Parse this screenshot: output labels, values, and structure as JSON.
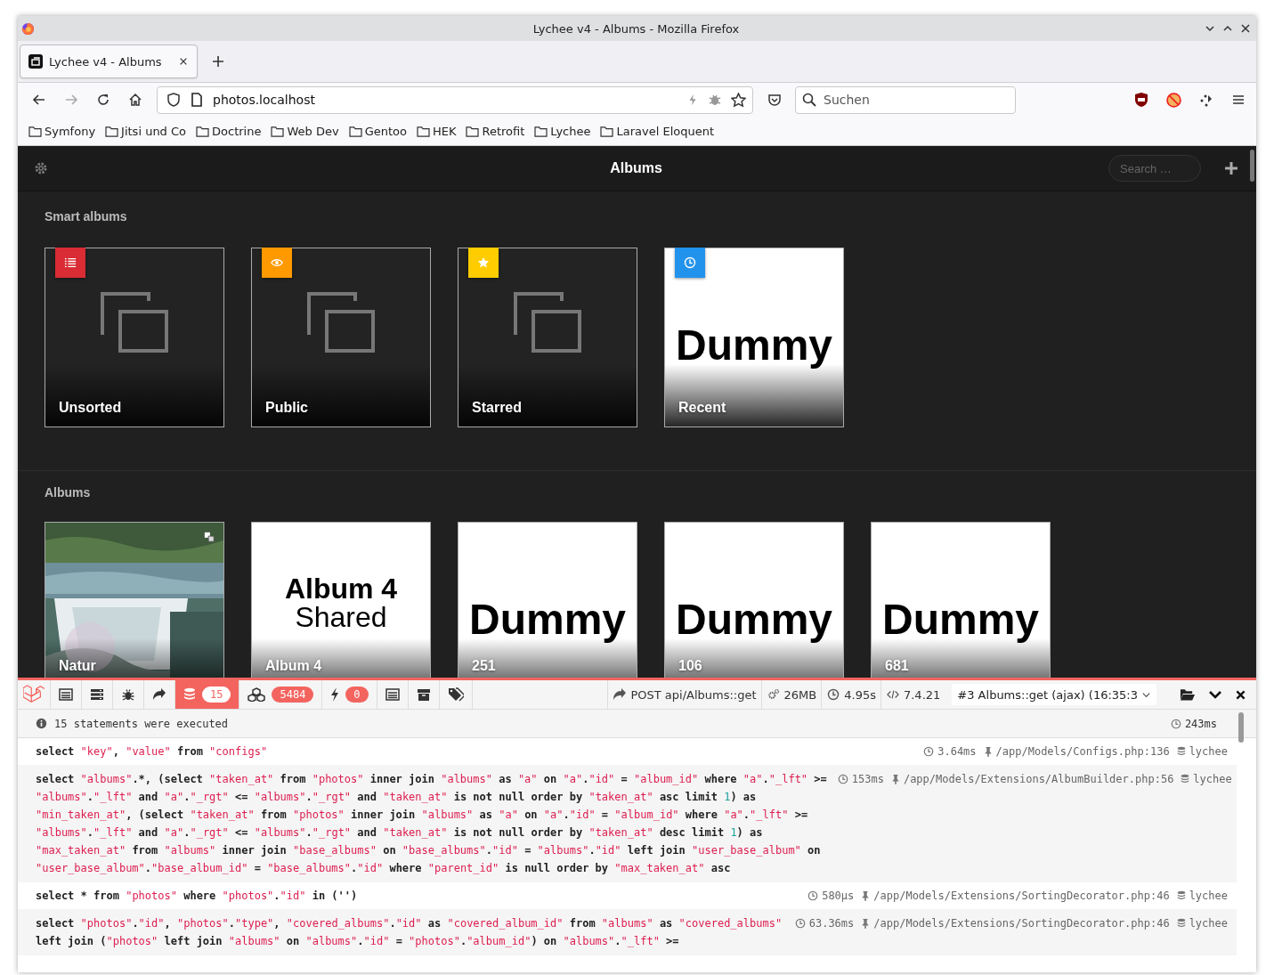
{
  "window": {
    "title": "Lychee v4 - Albums - Mozilla Firefox"
  },
  "tabs": [
    {
      "label": "Lychee v4 - Albums",
      "selected": true
    }
  ],
  "address_bar": {
    "value": "photos.localhost"
  },
  "search_bar": {
    "placeholder": "Suchen"
  },
  "bookmarks": [
    "Symfony",
    "Jitsi und Co",
    "Doctrine",
    "Web Dev",
    "Gentoo",
    "HEK",
    "Retrofit",
    "Lychee",
    "Laravel Eloquent"
  ],
  "app": {
    "title": "Albums",
    "search": {
      "placeholder": "Search …"
    }
  },
  "smart_albums": {
    "heading": "Smart albums",
    "items": [
      {
        "title": "Unsorted",
        "kind": "unsorted",
        "color": "#d92c34"
      },
      {
        "title": "Public",
        "kind": "public",
        "color": "#ff9900"
      },
      {
        "title": "Starred",
        "kind": "starred",
        "color": "#ffcc00"
      },
      {
        "title": "Recent",
        "kind": "recent",
        "color": "#2293ec",
        "cover_text": [
          "Dummy"
        ]
      }
    ]
  },
  "albums": {
    "heading": "Albums",
    "items": [
      {
        "title": "Natur",
        "kind": "picture"
      },
      {
        "title": "Album 4",
        "kind": "text",
        "cover_text": [
          "Album 4",
          "Shared"
        ]
      },
      {
        "title": "251",
        "kind": "text",
        "cover_text": [
          "Dummy"
        ]
      },
      {
        "title": "106",
        "kind": "text",
        "cover_text": [
          "Dummy"
        ]
      },
      {
        "title": "681",
        "kind": "text",
        "cover_text": [
          "Dummy"
        ]
      }
    ]
  },
  "debugbar": {
    "tabs": [
      {
        "kind": "messages",
        "selected": false
      },
      {
        "kind": "timeline",
        "selected": false
      },
      {
        "kind": "exceptions",
        "selected": false
      },
      {
        "kind": "route",
        "selected": false
      },
      {
        "kind": "queries",
        "badge": "15",
        "selected": true
      },
      {
        "kind": "models",
        "badge": "5484",
        "selected": false
      },
      {
        "kind": "events",
        "badge": "0",
        "selected": false
      },
      {
        "kind": "views",
        "selected": false
      },
      {
        "kind": "session",
        "selected": false
      },
      {
        "kind": "tags",
        "selected": false
      }
    ],
    "request": "POST api/Albums::get",
    "memory": "26MB",
    "duration": "4.95s",
    "php_version": "7.4.21",
    "request_select": {
      "value": "#3 Albums::get (ajax) (16:35:3"
    },
    "queries": {
      "summary": "15 statements were executed",
      "total_time": "243ms",
      "statements": [
        {
          "lines": [
            "select \"key\", \"value\" from \"configs\""
          ],
          "duration": "3.64ms",
          "source": "/app/Models/Configs.php:136",
          "connection": "lychee"
        },
        {
          "lines": [
            "select \"albums\".*, (select \"taken_at\" from \"photos\" inner join \"albums\" as \"a\" on \"a\".\"id\" = \"album_id\" where \"a\".\"_lft\" >=",
            "\"albums\".\"_lft\" and \"a\".\"_rgt\" <= \"albums\".\"_rgt\" and \"taken_at\" is not null order by \"taken_at\" asc limit 1) as",
            "\"min_taken_at\", (select \"taken_at\" from \"photos\" inner join \"albums\" as \"a\" on \"a\".\"id\" = \"album_id\" where \"a\".\"_lft\" >=",
            "\"albums\".\"_lft\" and \"a\".\"_rgt\" <= \"albums\".\"_rgt\" and \"taken_at\" is not null order by \"taken_at\" desc limit 1) as",
            "\"max_taken_at\" from \"albums\" inner join \"base_albums\" on \"base_albums\".\"id\" = \"albums\".\"id\" left join \"user_base_album\" on",
            "\"user_base_album\".\"base_album_id\" = \"base_albums\".\"id\" where \"parent_id\" is null order by \"max_taken_at\" asc"
          ],
          "duration": "153ms",
          "source": "/app/Models/Extensions/AlbumBuilder.php:56",
          "connection": "lychee"
        },
        {
          "lines": [
            "select * from \"photos\" where \"photos\".\"id\" in ('')"
          ],
          "duration": "580μs",
          "source": "/app/Models/Extensions/SortingDecorator.php:46",
          "connection": "lychee"
        },
        {
          "lines": [
            "select \"photos\".\"id\", \"photos\".\"type\", \"covered_albums\".\"id\" as \"covered_album_id\" from \"albums\" as \"covered_albums\"",
            "left join (\"photos\" left join \"albums\" on \"albums\".\"id\" = \"photos\".\"album_id\") on \"albums\".\"_lft\" >="
          ],
          "duration": "63.36ms",
          "source": "/app/Models/Extensions/SortingDecorator.php:46",
          "connection": "lychee"
        }
      ]
    }
  }
}
